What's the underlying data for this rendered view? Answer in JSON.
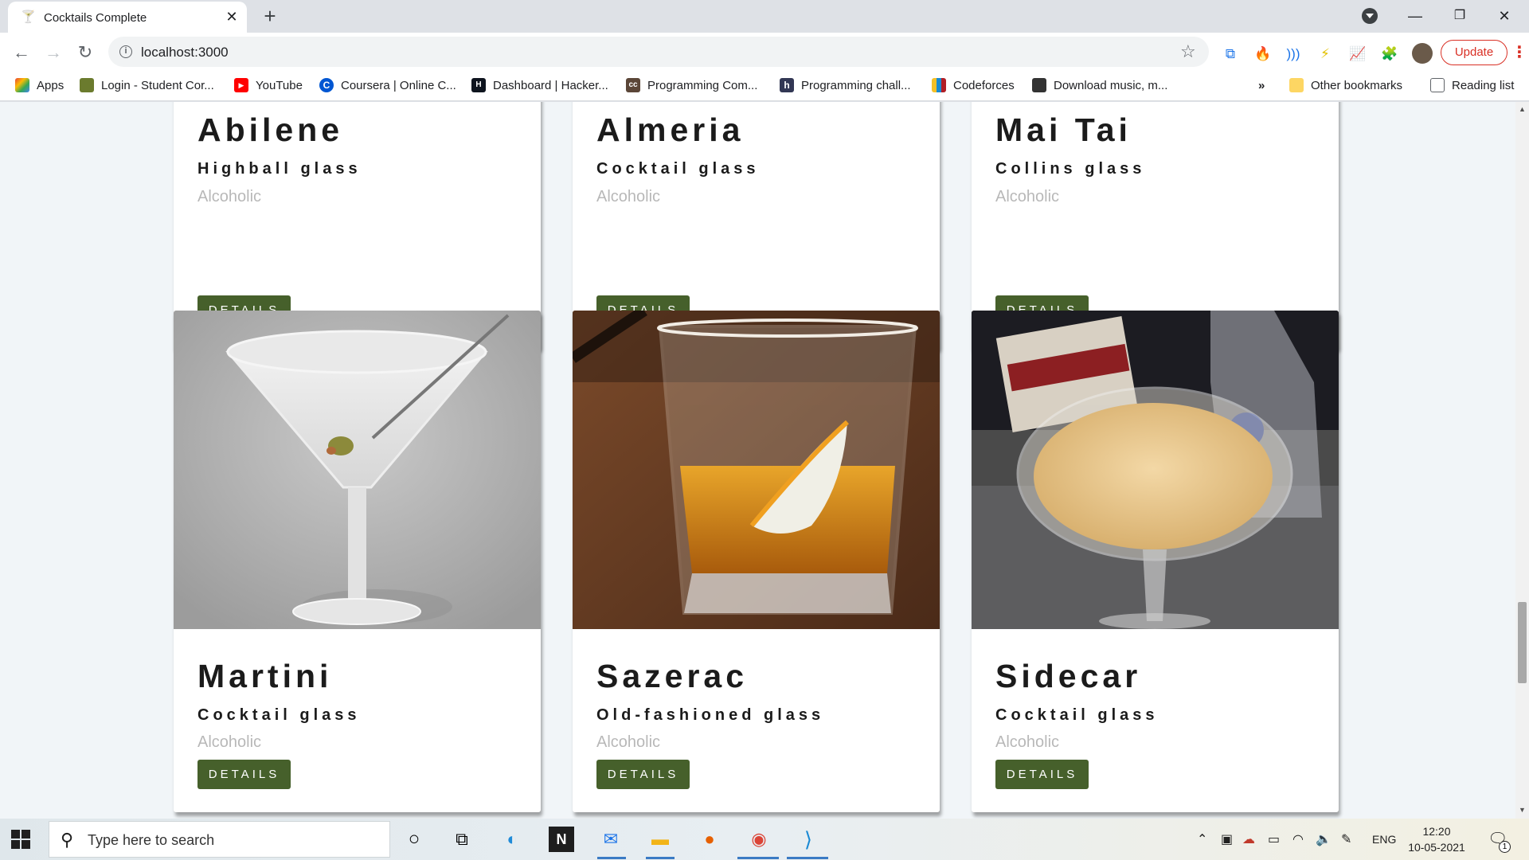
{
  "browser": {
    "tab": {
      "title": "Cocktails Complete",
      "favicon": "cocktail-glass-icon"
    },
    "url": "localhost:3000",
    "update_label": "Update",
    "bookmarks": [
      {
        "label": "Apps",
        "icon": "apps-grid-icon"
      },
      {
        "label": "Login - Student Cor...",
        "icon": "frog-icon"
      },
      {
        "label": "YouTube",
        "icon": "youtube-icon"
      },
      {
        "label": "Coursera | Online C...",
        "icon": "coursera-icon"
      },
      {
        "label": "Dashboard | Hacker...",
        "icon": "hackerrank-icon"
      },
      {
        "label": "Programming Com...",
        "icon": "codechef-icon"
      },
      {
        "label": "Programming chall...",
        "icon": "hackerearth-icon"
      },
      {
        "label": "Codeforces",
        "icon": "codeforces-icon"
      },
      {
        "label": "Download music, m...",
        "icon": "download-icon"
      }
    ],
    "overflow_label": "»",
    "other_bookmarks": "Other bookmarks",
    "reading_list": "Reading list"
  },
  "cards_top": [
    {
      "name": "Abilene",
      "glass": "Highball glass",
      "type": "Alcoholic",
      "button": "DETAILS"
    },
    {
      "name": "Almeria",
      "glass": "Cocktail glass",
      "type": "Alcoholic",
      "button": "DETAILS"
    },
    {
      "name": "Mai Tai",
      "glass": "Collins glass",
      "type": "Alcoholic",
      "button": "DETAILS"
    }
  ],
  "cards_bottom": [
    {
      "name": "Martini",
      "glass": "Cocktail glass",
      "type": "Alcoholic",
      "button": "DETAILS"
    },
    {
      "name": "Sazerac",
      "glass": "Old-fashioned glass",
      "type": "Alcoholic",
      "button": "DETAILS"
    },
    {
      "name": "Sidecar",
      "glass": "Cocktail glass",
      "type": "Alcoholic",
      "button": "DETAILS"
    }
  ],
  "taskbar": {
    "search_placeholder": "Type here to search",
    "language": "ENG",
    "time": "12:20",
    "date": "10-05-2021",
    "notification_count": "1"
  }
}
